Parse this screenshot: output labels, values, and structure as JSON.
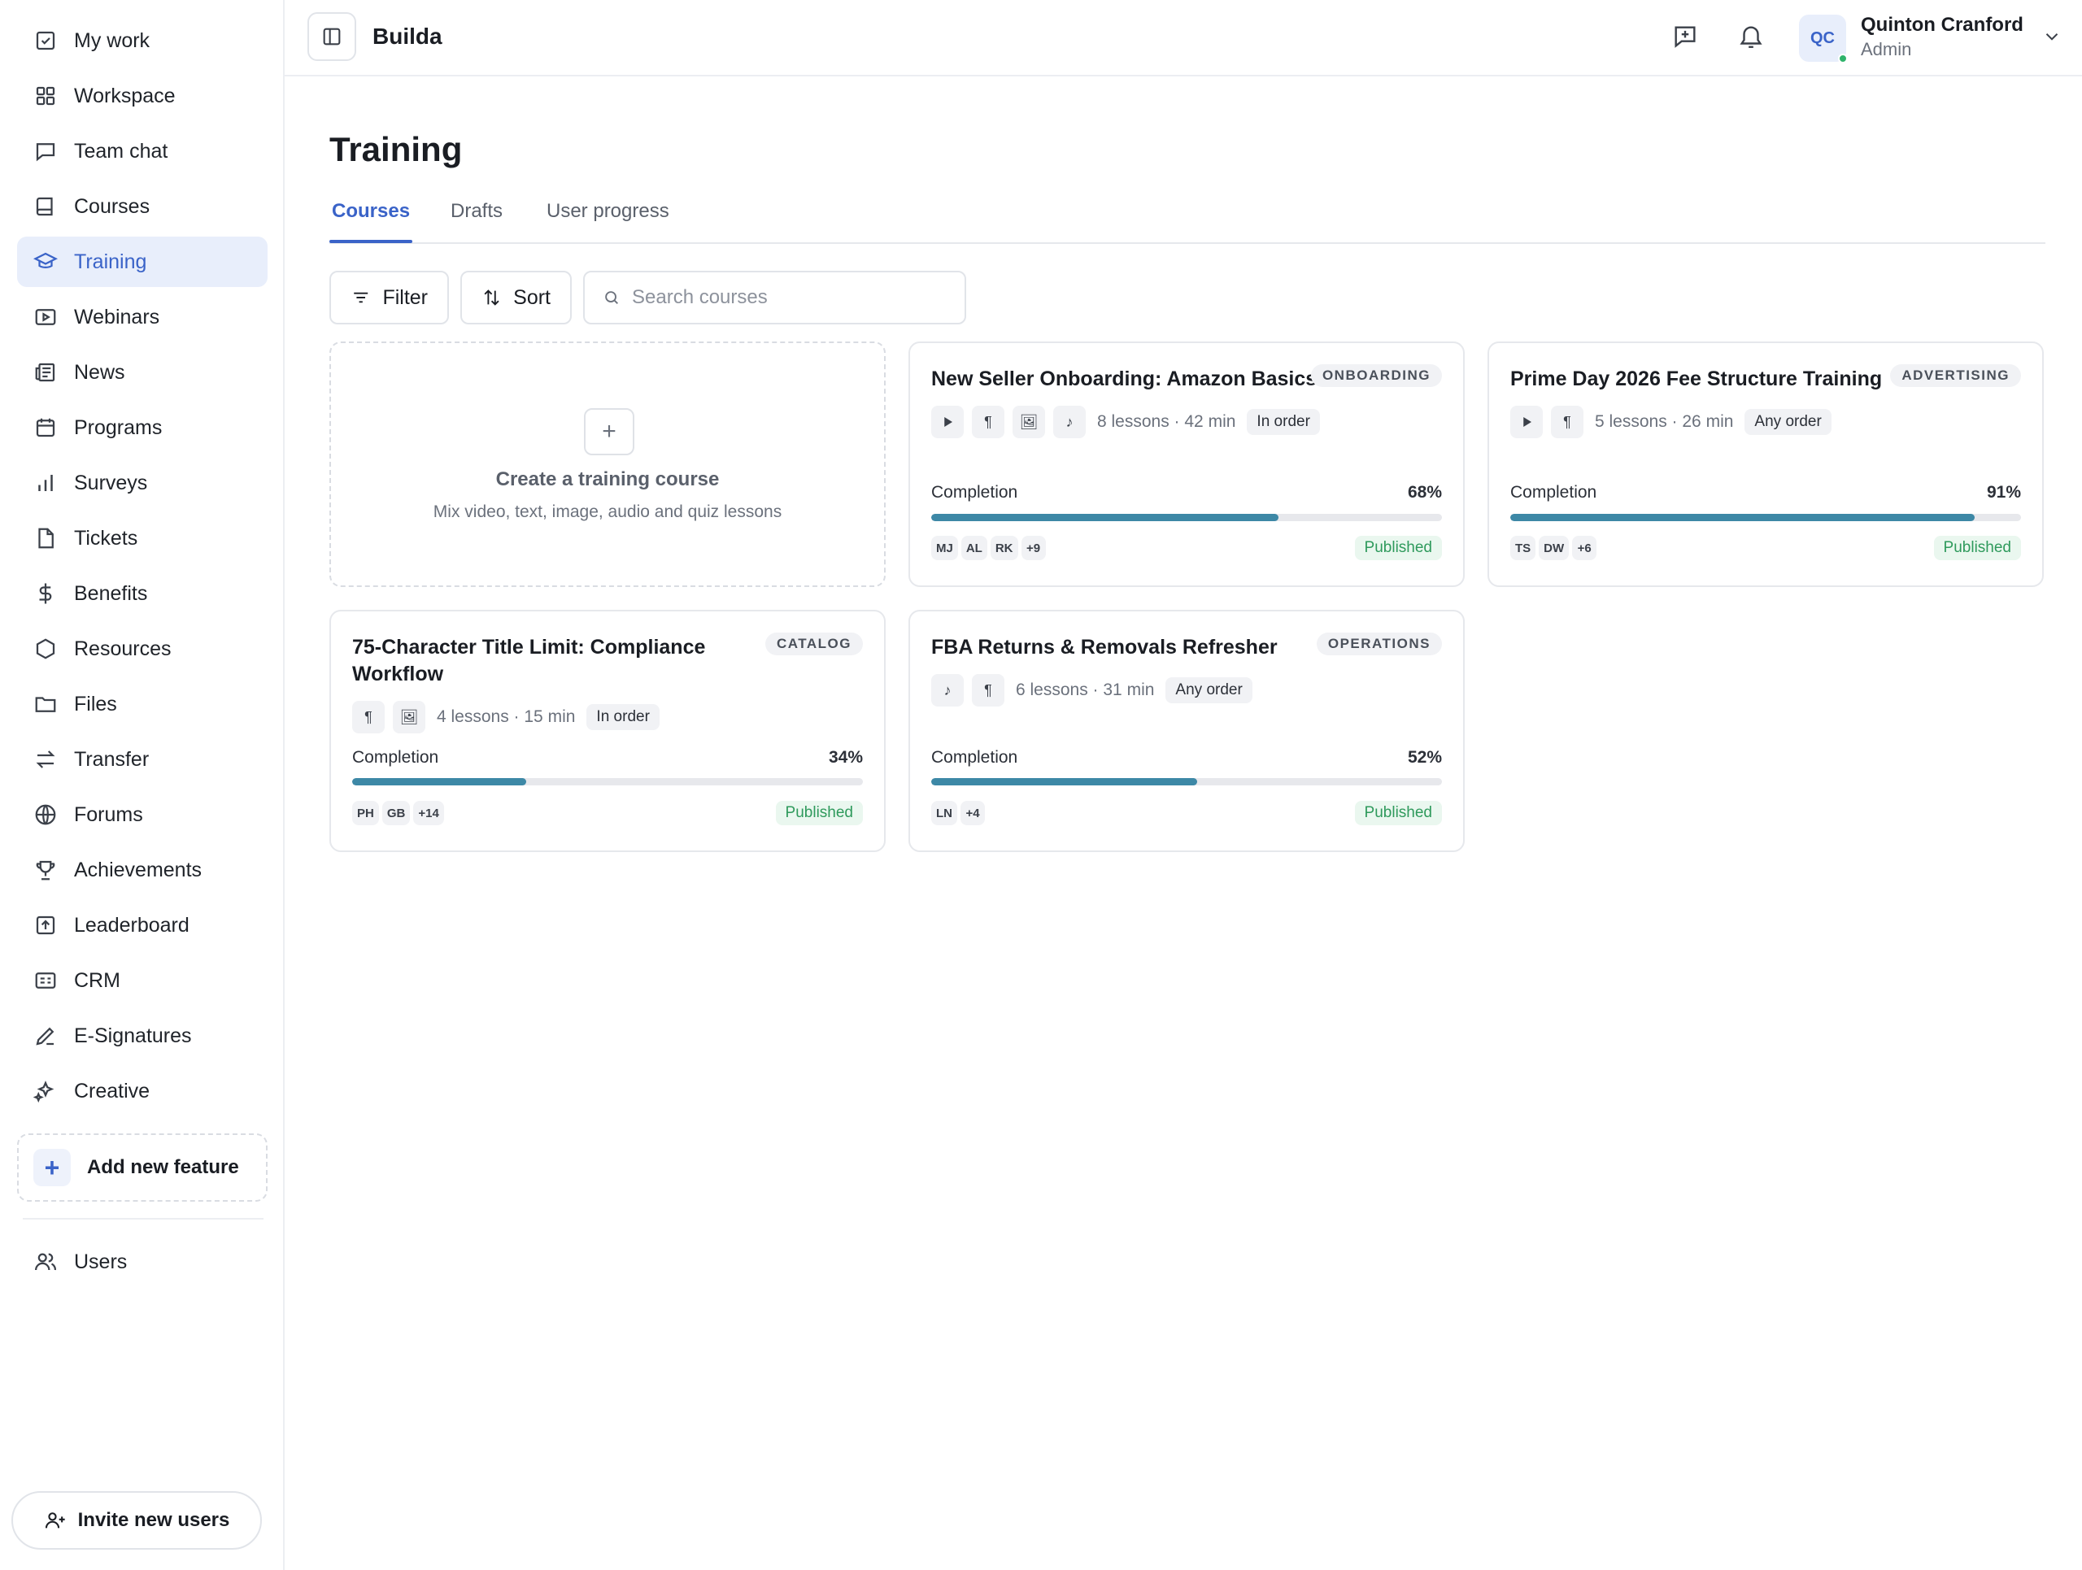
{
  "sidebar": {
    "items": [
      {
        "label": "My work",
        "icon": "check-square-icon"
      },
      {
        "label": "Workspace",
        "icon": "grid-icon"
      },
      {
        "label": "Team chat",
        "icon": "chat-icon"
      },
      {
        "label": "Courses",
        "icon": "book-icon"
      },
      {
        "label": "Training",
        "icon": "graduation-cap-icon",
        "active": true
      },
      {
        "label": "Webinars",
        "icon": "video-icon"
      },
      {
        "label": "News",
        "icon": "newspaper-icon"
      },
      {
        "label": "Programs",
        "icon": "calendar-icon"
      },
      {
        "label": "Surveys",
        "icon": "bar-chart-icon"
      },
      {
        "label": "Tickets",
        "icon": "file-icon"
      },
      {
        "label": "Benefits",
        "icon": "dollar-icon"
      },
      {
        "label": "Resources",
        "icon": "hexagon-icon"
      },
      {
        "label": "Files",
        "icon": "folder-icon"
      },
      {
        "label": "Transfer",
        "icon": "arrows-icon"
      },
      {
        "label": "Forums",
        "icon": "globe-icon"
      },
      {
        "label": "Achievements",
        "icon": "trophy-icon"
      },
      {
        "label": "Leaderboard",
        "icon": "upload-box-icon"
      },
      {
        "label": "CRM",
        "icon": "id-card-icon"
      },
      {
        "label": "E-Signatures",
        "icon": "pen-icon"
      },
      {
        "label": "Creative",
        "icon": "sparkles-icon"
      }
    ],
    "add_feature_label": "Add new feature",
    "users_label": "Users",
    "invite_label": "Invite new users"
  },
  "header": {
    "brand": "Builda",
    "user": {
      "initials": "QC",
      "name": "Quinton Cranford",
      "role": "Admin"
    }
  },
  "main": {
    "title": "Training",
    "tabs": [
      {
        "label": "Courses",
        "active": true
      },
      {
        "label": "Drafts"
      },
      {
        "label": "User progress"
      }
    ],
    "filter_label": "Filter",
    "sort_label": "Sort",
    "search_placeholder": "Search courses",
    "create_card": {
      "title": "Create a training course",
      "subtitle": "Mix video, text, image, audio and quiz lessons"
    },
    "completion_label": "Completion",
    "courses": [
      {
        "title": "New Seller Onboarding: Amazon Basics",
        "tag": "ONBOARDING",
        "lesson_types": [
          "video",
          "text",
          "image",
          "audio"
        ],
        "meta": "8 lessons · 42 min",
        "order": "In order",
        "completion": 68,
        "completion_text": "68%",
        "avatars": [
          "MJ",
          "AL",
          "RK",
          "+9"
        ],
        "status": "Published"
      },
      {
        "title": "Prime Day 2026 Fee Structure Training",
        "tag": "ADVERTISING",
        "lesson_types": [
          "video",
          "text"
        ],
        "meta": "5 lessons · 26 min",
        "order": "Any order",
        "completion": 91,
        "completion_text": "91%",
        "avatars": [
          "TS",
          "DW",
          "+6"
        ],
        "status": "Published"
      },
      {
        "title": "75-Character Title Limit: Compliance Workflow",
        "tag": "CATALOG",
        "lesson_types": [
          "text",
          "image"
        ],
        "meta": "4 lessons · 15 min",
        "order": "In order",
        "completion": 34,
        "completion_text": "34%",
        "avatars": [
          "PH",
          "GB",
          "+14"
        ],
        "status": "Published"
      },
      {
        "title": "FBA Returns & Removals Refresher",
        "tag": "OPERATIONS",
        "lesson_types": [
          "audio",
          "text"
        ],
        "meta": "6 lessons · 31 min",
        "order": "Any order",
        "completion": 52,
        "completion_text": "52%",
        "avatars": [
          "LN",
          "+4"
        ],
        "status": "Published"
      }
    ]
  },
  "colors": {
    "accent": "#3a63c8",
    "active_bg": "#e8eefb",
    "progress": "#3d88a6",
    "published": "#2f9a5c"
  }
}
